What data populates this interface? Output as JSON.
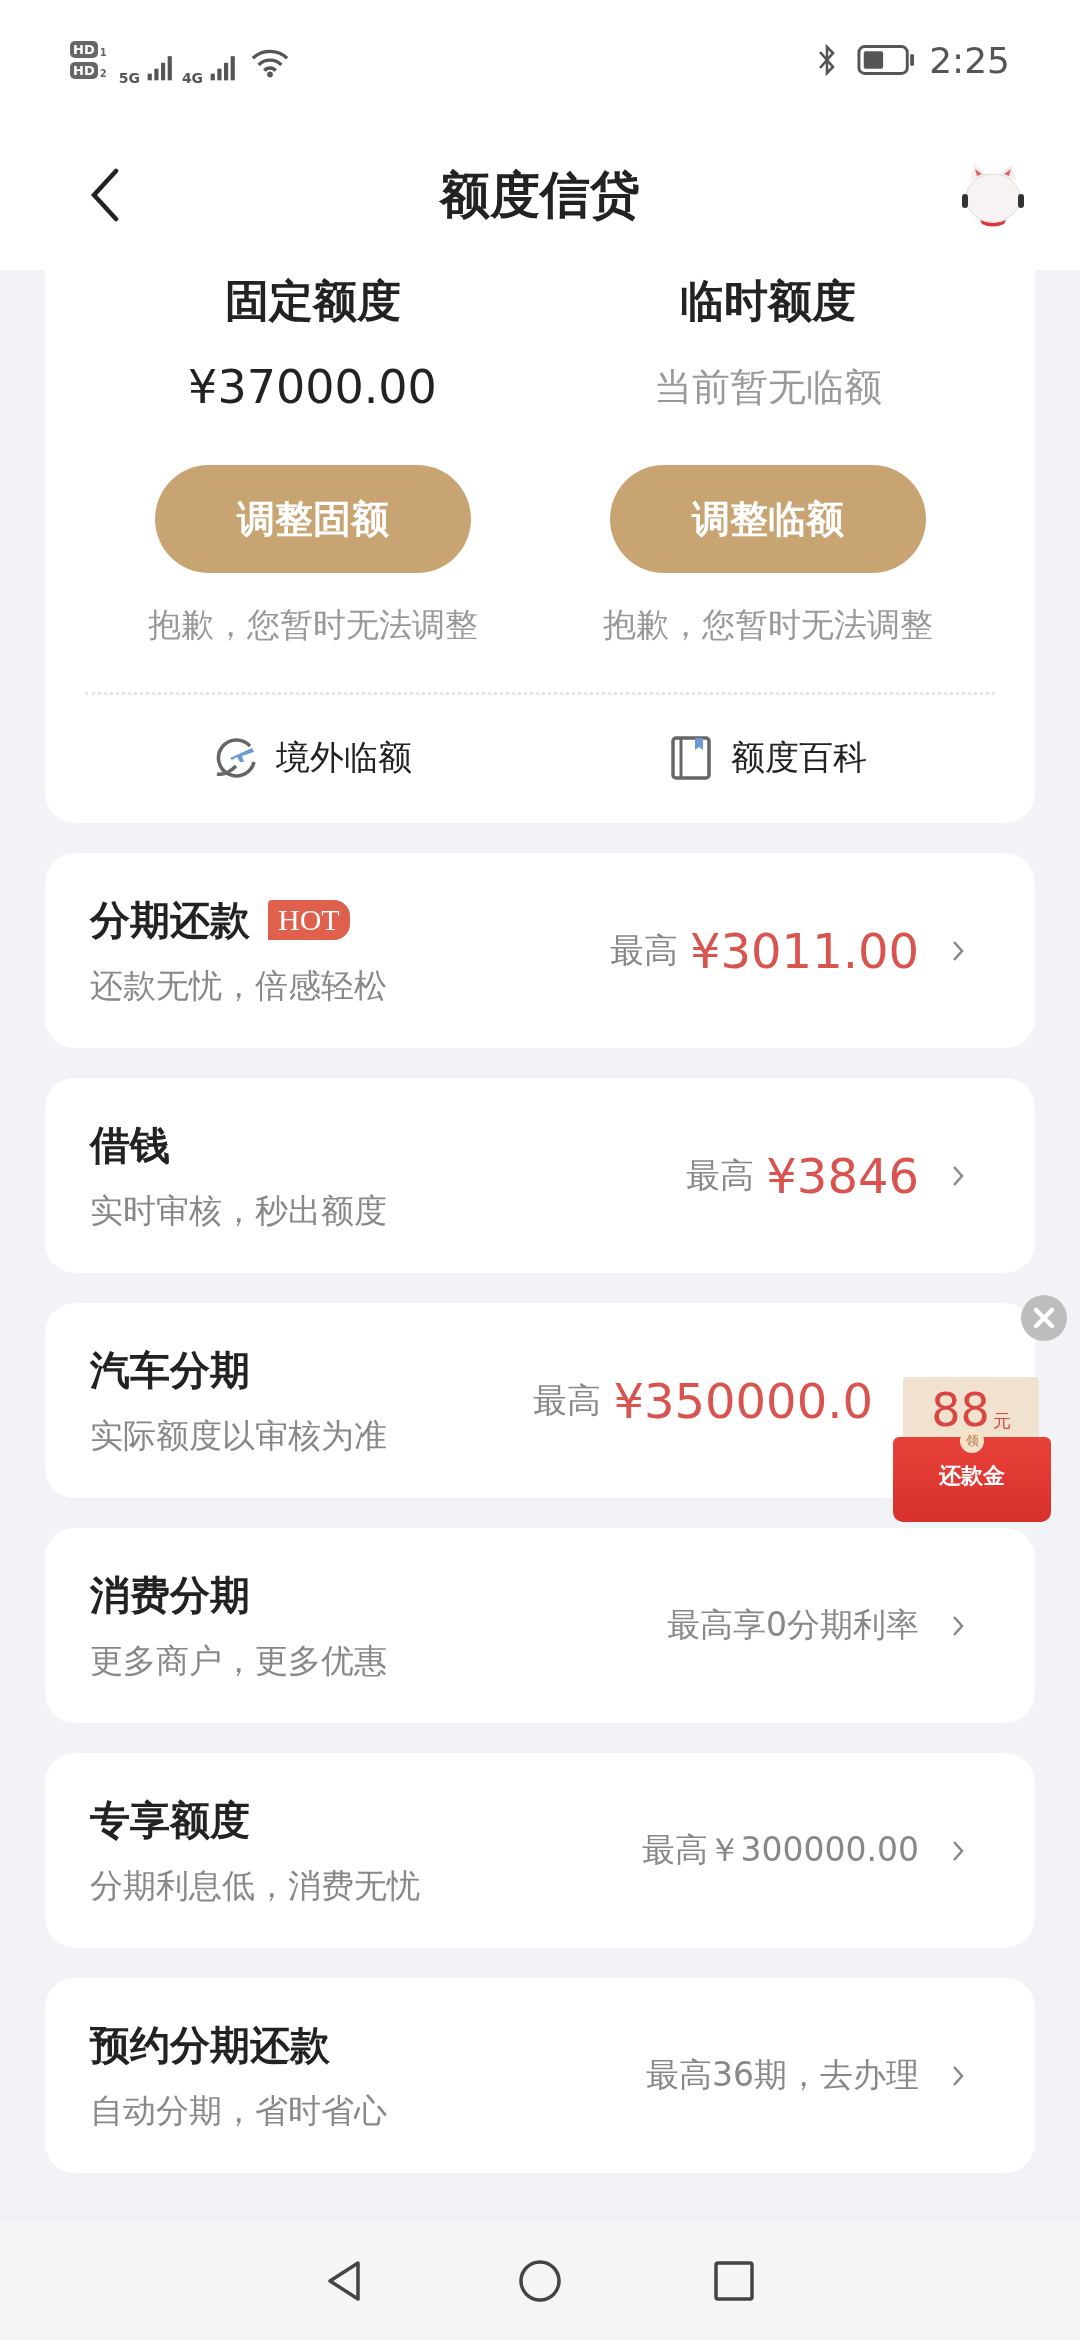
{
  "status_bar": {
    "sims": [
      {
        "badge": "HD",
        "slot": "1"
      },
      {
        "badge": "HD",
        "slot": "2"
      }
    ],
    "networks": [
      "5G",
      "4G"
    ],
    "time": "2:25"
  },
  "header": {
    "title": "额度信贷"
  },
  "limits": [
    {
      "heading": "固定额度",
      "value": "¥37000.00",
      "muted": false,
      "button": "调整固额",
      "note": "抱歉，您暂时无法调整"
    },
    {
      "heading": "临时额度",
      "value": "当前暂无临额",
      "muted": true,
      "button": "调整临额",
      "note": "抱歉，您暂时无法调整"
    }
  ],
  "links": [
    {
      "kind": "plane",
      "label": "境外临额"
    },
    {
      "kind": "book",
      "label": "额度百科"
    }
  ],
  "products": [
    {
      "title": "分期还款",
      "badge": "HOT",
      "subtitle": "还款无忧，倍感轻松",
      "kind": "amount",
      "prefix": "最高",
      "amount": "¥3011.00",
      "chevron": true
    },
    {
      "title": "借钱",
      "subtitle": "实时审核，秒出额度",
      "kind": "amount",
      "prefix": "最高",
      "amount": "¥3846",
      "chevron": true
    },
    {
      "title": "汽车分期",
      "subtitle": "实际额度以审核为准",
      "kind": "amount",
      "prefix": "最高",
      "amount": "¥350000.0",
      "chevron": false
    },
    {
      "title": "消费分期",
      "subtitle": "更多商户，更多优惠",
      "kind": "text",
      "text": "最高享0分期利率",
      "chevron": true
    },
    {
      "title": "专享额度",
      "subtitle": "分期利息低，消费无忧",
      "kind": "text",
      "text": "最高￥300000.00",
      "chevron": true
    },
    {
      "title": "预约分期还款",
      "subtitle": "自动分期，省时省心",
      "kind": "text",
      "text": "最高36期，去办理",
      "chevron": true
    }
  ],
  "red_packet": {
    "amount": "88",
    "unit": "元",
    "seal": "领",
    "label": "还款金"
  }
}
